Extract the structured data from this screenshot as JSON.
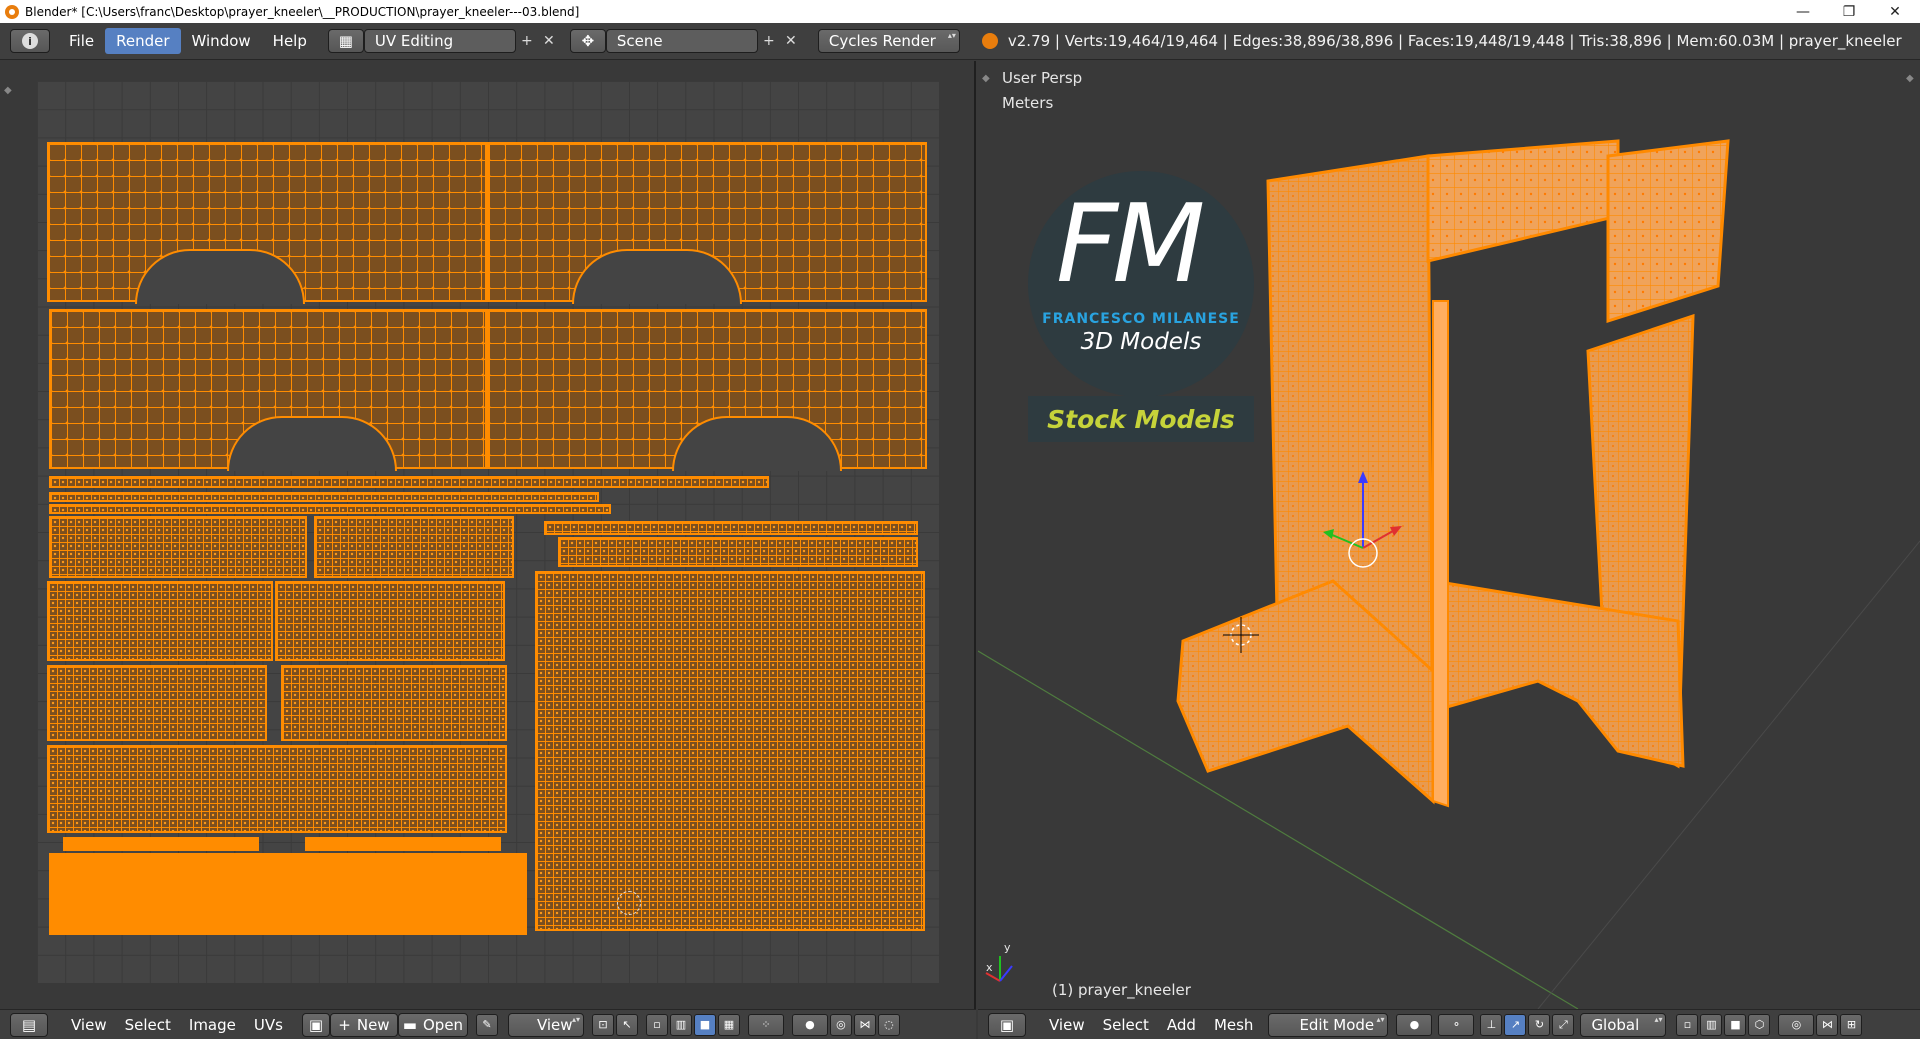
{
  "window": {
    "title": "Blender* [C:\\Users\\franc\\Desktop\\prayer_kneeler\\__PRODUCTION\\prayer_kneeler---03.blend]",
    "minimize": "—",
    "maximize": "❐",
    "close": "✕"
  },
  "infobar": {
    "editor_icon": "i",
    "menus": [
      "File",
      "Render",
      "Window",
      "Help"
    ],
    "active_menu": "Render",
    "screen_layout": "UV Editing",
    "scene": "Scene",
    "render_engine": "Cycles Render",
    "stats": "v2.79 | Verts:19,464/19,464 | Edges:38,896/38,896 | Faces:19,448/19,448 | Tris:38,896 | Mem:60.03M | prayer_kneeler"
  },
  "uv_editor": {
    "menus": [
      "View",
      "Select",
      "Image",
      "UVs"
    ],
    "new_label": "New",
    "open_label": "Open",
    "view_label": "View"
  },
  "viewport": {
    "view_name": "User Persp",
    "units": "Meters",
    "object_label": "(1) prayer_kneeler",
    "menus": [
      "View",
      "Select",
      "Add",
      "Mesh"
    ],
    "mode": "Edit Mode",
    "orientation": "Global",
    "axis_y": "y",
    "axis_x": "x"
  },
  "watermark": {
    "logo_letters": "FM",
    "author": "FRANCESCO MILANESE",
    "tagline": "3D Models",
    "badge": "Stock Models"
  },
  "colors": {
    "accent": "#5680c2",
    "selection": "#ff8c00",
    "background": "#393939",
    "badge_text": "#c6d33a",
    "logo_blue": "#29a3e0"
  }
}
